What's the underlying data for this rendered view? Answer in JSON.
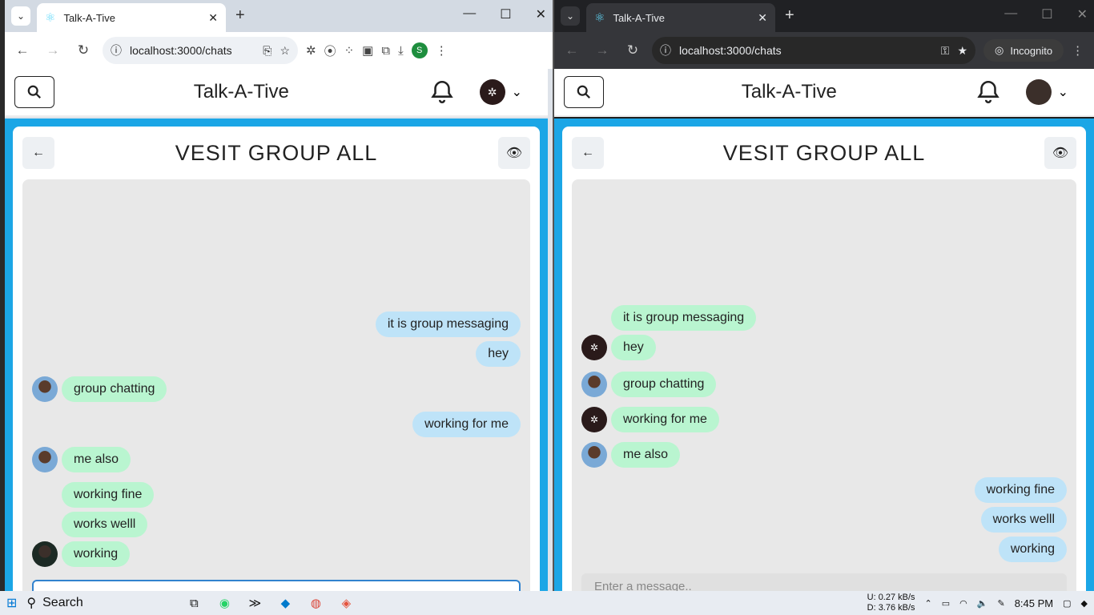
{
  "left_window": {
    "tab_title": "Talk-A-Tive",
    "url": "localhost:3000/chats",
    "profile_initial": "S",
    "app": {
      "title": "Talk-A-Tive",
      "group_name": "VESIT GROUP ALL",
      "messages": [
        {
          "text": "it is group messaging",
          "mine": true
        },
        {
          "text": "hey",
          "mine": true
        },
        {
          "text": "group chatting",
          "mine": false,
          "avatar": "boy"
        },
        {
          "text": "working for me",
          "mine": true
        },
        {
          "text": "me also",
          "mine": false,
          "avatar": "boy"
        },
        {
          "text": "working fine",
          "mine": false,
          "avatar": ""
        },
        {
          "text": "works welll",
          "mine": false,
          "avatar": ""
        },
        {
          "text": "working",
          "mine": false,
          "avatar": "man"
        }
      ]
    }
  },
  "right_window": {
    "tab_title": "Talk-A-Tive",
    "url": "localhost:3000/chats",
    "incognito_label": "Incognito",
    "app": {
      "title": "Talk-A-Tive",
      "group_name": "VESIT GROUP ALL",
      "input_placeholder": "Enter a message..",
      "messages": [
        {
          "text": "it is group messaging",
          "mine": false,
          "avatar": ""
        },
        {
          "text": "hey",
          "mine": false,
          "avatar": "dark"
        },
        {
          "text": "group chatting",
          "mine": false,
          "avatar": "boy"
        },
        {
          "text": "working for me",
          "mine": false,
          "avatar": "dark"
        },
        {
          "text": "me also",
          "mine": false,
          "avatar": "boy"
        },
        {
          "text": "working fine",
          "mine": true
        },
        {
          "text": "works welll",
          "mine": true
        },
        {
          "text": "working",
          "mine": true
        }
      ]
    }
  },
  "taskbar": {
    "search_label": "Search",
    "upload": "U:",
    "upload_rate": "0.27 kB/s",
    "download": "D:",
    "download_rate": "3.76 kB/s",
    "time": "8:45 PM"
  },
  "colors": {
    "my_bubble": "#bee3f8",
    "other_bubble": "#b9f5d0",
    "background_blue": "#1ba6e6"
  }
}
